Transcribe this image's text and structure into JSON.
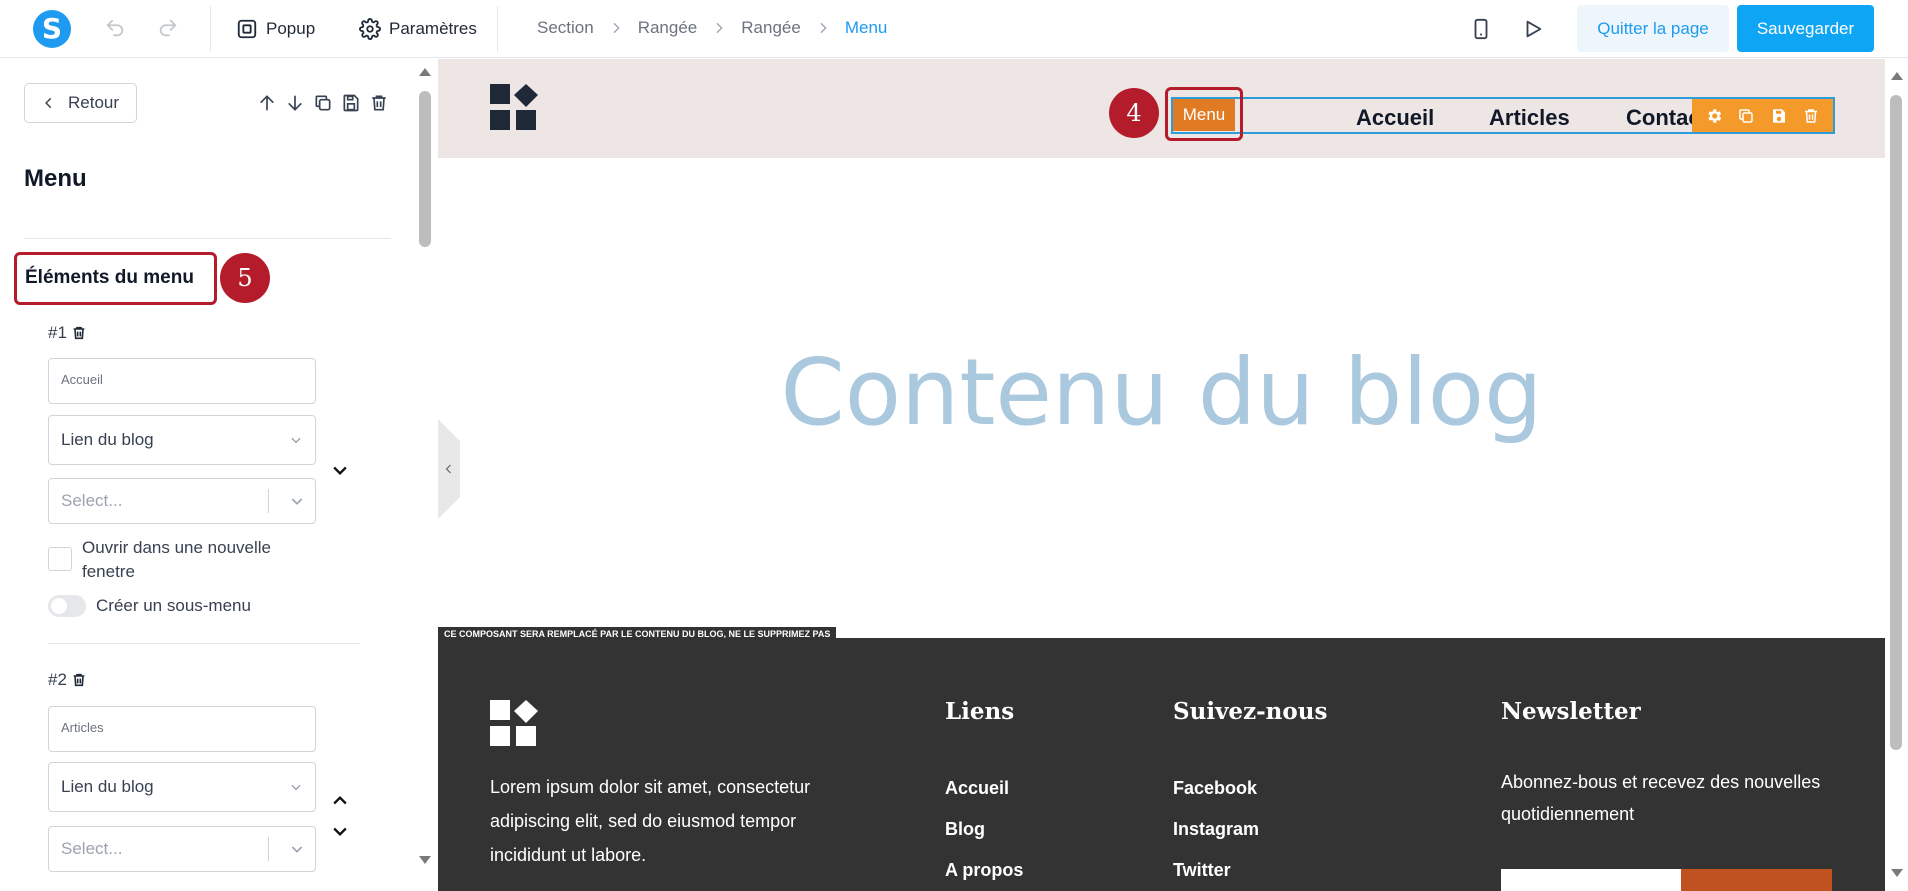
{
  "topbar": {
    "logo_letter": "S",
    "popup_label": "Popup",
    "settings_label": "Paramètres",
    "breadcrumbs": [
      "Section",
      "Rangée",
      "Rangée",
      "Menu"
    ],
    "quit_label": "Quitter la page",
    "save_label": "Sauvegarder"
  },
  "panel": {
    "back_label": "Retour",
    "title": "Menu",
    "section_title": "Éléments du menu",
    "section_badge": "5",
    "items": [
      {
        "number": "#1",
        "text_value": "Accueil",
        "link_type": "Lien du blog",
        "select_placeholder": "Select...",
        "new_window_label": "Ouvrir dans une nouvelle fenetre",
        "submenu_label": "Créer un sous-menu"
      },
      {
        "number": "#2",
        "text_value": "Articles",
        "link_type": "Lien du blog",
        "select_placeholder": "Select..."
      }
    ]
  },
  "canvas": {
    "menu_tag": "Menu",
    "menu_badge": "4",
    "nav": [
      "Accueil",
      "Articles",
      "Contac"
    ],
    "hero": "Contenu du blog",
    "notice": "CE COMPOSANT SERA REMPLACÉ PAR LE CONTENU DU BLOG, NE LE SUPPRIMEZ PAS",
    "footer": {
      "description": "Lorem ipsum dolor sit amet, consectetur adipiscing elit, sed do eiusmod tempor incididunt ut labore.",
      "links_title": "Liens",
      "links": [
        "Accueil",
        "Blog",
        "A propos"
      ],
      "follow_title": "Suivez-nous",
      "follow": [
        "Facebook",
        "Instagram",
        "Twitter"
      ],
      "newsletter_title": "Newsletter",
      "newsletter_desc": "Abonnez-bous et recevez des nouvelles quotidiennement"
    }
  },
  "colors": {
    "accent": "#1e9bf0",
    "annotation_red": "#b41c2b",
    "menu_orange": "#e07b24",
    "footer_bg": "#333333",
    "header_bg": "#ede6e4",
    "hero_text": "#aac8de"
  },
  "icons": [
    "undo-icon",
    "redo-icon",
    "popup-icon",
    "gear-icon",
    "chevron-right-icon",
    "mobile-icon",
    "play-icon",
    "chevron-left-icon",
    "arrow-up-icon",
    "arrow-down-icon",
    "copy-icon",
    "save-icon",
    "trash-icon",
    "chevron-down-icon",
    "chevron-up-icon"
  ]
}
